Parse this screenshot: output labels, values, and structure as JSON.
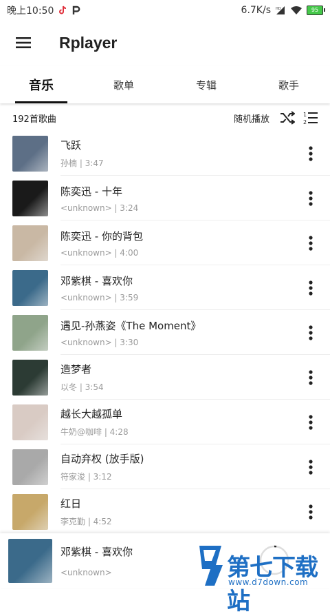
{
  "status_bar": {
    "time": "晚上10:50",
    "speed": "6.7K/s",
    "battery": "95"
  },
  "app_bar": {
    "title": "Rplayer",
    "menu_icon": "hamburger-menu-icon"
  },
  "tabs": [
    {
      "label": "音乐",
      "active": true
    },
    {
      "label": "歌单",
      "active": false
    },
    {
      "label": "专辑",
      "active": false
    },
    {
      "label": "歌手",
      "active": false
    }
  ],
  "list_header": {
    "count": "192首歌曲",
    "shuffle_label": "随机播放",
    "icons": [
      "shuffle-icon",
      "sort-list-icon"
    ]
  },
  "songs": [
    {
      "title": "飞跃",
      "subtitle": "孙楠 | 3:47",
      "cover_color": "#5d6f86"
    },
    {
      "title": "陈奕迅 - 十年",
      "subtitle": "<unknown> | 3:24",
      "cover_color": "#1a1a1a"
    },
    {
      "title": "陈奕迅 - 你的背包",
      "subtitle": "<unknown> | 4:00",
      "cover_color": "#c9b8a4"
    },
    {
      "title": "邓紫棋 - 喜欢你",
      "subtitle": "<unknown> | 3:59",
      "cover_color": "#3b6a8a"
    },
    {
      "title": "遇见-孙燕姿《The Moment》",
      "subtitle": "<unknown> | 3:30",
      "cover_color": "#8fa48a"
    },
    {
      "title": "造梦者",
      "subtitle": "以冬 | 3:54",
      "cover_color": "#2c3b34"
    },
    {
      "title": "越长大越孤单",
      "subtitle": "牛奶@咖啡 | 4:28",
      "cover_color": "#d9cbc4"
    },
    {
      "title": "自动弃权 (放手版)",
      "subtitle": "符家浚 | 3:12",
      "cover_color": "#a9a9a9"
    },
    {
      "title": "红日",
      "subtitle": "李克勤 | 4:52",
      "cover_color": "#c7a86a"
    }
  ],
  "mini_player": {
    "title": "邓紫棋 - 喜欢你",
    "subtitle": "<unknown>",
    "cover_color": "#3b6a8a"
  },
  "watermark": {
    "title": "第七下载站",
    "url": "www.d7down.com"
  }
}
